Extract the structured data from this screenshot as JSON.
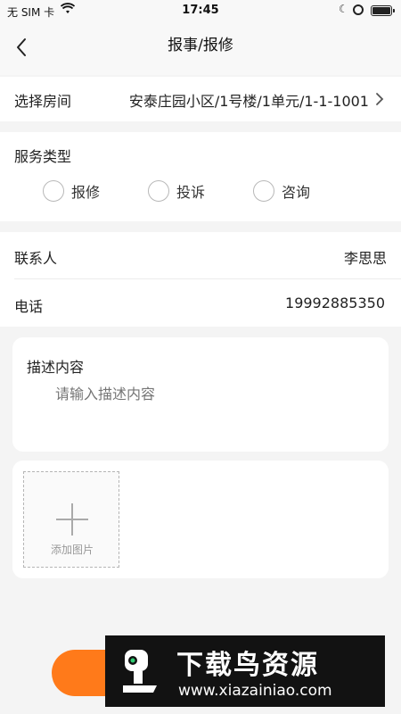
{
  "status_bar": {
    "carrier": "无 SIM 卡",
    "time": "17:45"
  },
  "nav": {
    "title": "报事/报修"
  },
  "room": {
    "label": "选择房间",
    "value": "安泰庄园小区/1号楼/1单元/1-1-1001"
  },
  "service": {
    "label": "服务类型",
    "options": [
      "报修",
      "投诉",
      "咨询"
    ]
  },
  "contact": {
    "label": "联系人",
    "value": "李思思"
  },
  "phone": {
    "label": "电话",
    "value": "19992885350"
  },
  "description": {
    "label": "描述内容",
    "placeholder": "请输入描述内容"
  },
  "photo": {
    "label": "添加图片"
  },
  "watermark": {
    "title": "下载鸟资源",
    "url": "www.xiazainiao.com"
  },
  "colors": {
    "accent": "#ff7a1a",
    "background": "#f4f4f4"
  },
  "icons": [
    "back-arrow-icon",
    "chevron-right-icon",
    "plus-icon",
    "wifi-icon",
    "moon-icon",
    "battery-icon"
  ]
}
